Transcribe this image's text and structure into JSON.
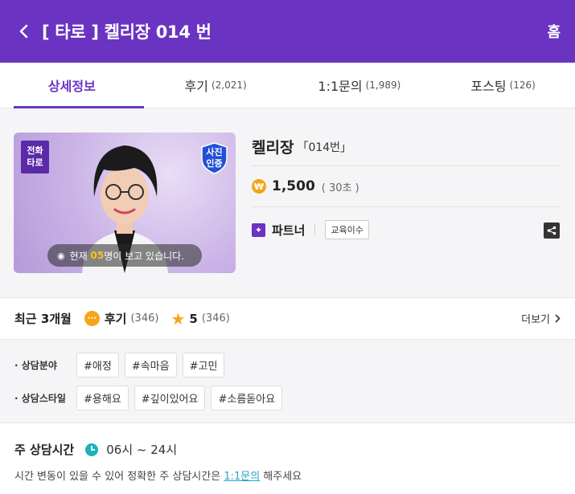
{
  "header": {
    "title": "[ 타로 ] 켈리장 014 번",
    "home": "홈"
  },
  "tabs": [
    {
      "label": "상세정보",
      "count": ""
    },
    {
      "label": "후기",
      "count": "(2,021)"
    },
    {
      "label": "1:1문의",
      "count": "(1,989)"
    },
    {
      "label": "포스팅",
      "count": "(126)"
    }
  ],
  "profile": {
    "badge_type": "전화\n타로",
    "badge_verified": "사진\n인증",
    "viewers_prefix": "현재",
    "viewers_count": "05",
    "viewers_suffix": "명이 보고 있습니다.",
    "name": "켈리장",
    "code": "「014번」",
    "coin_symbol": "₩",
    "price": "1,500",
    "unit": "( 30초 )",
    "partner_label": "파트너",
    "edu_label": "교육이수"
  },
  "reviews": {
    "title": "최근 3개월",
    "review_label": "후기",
    "review_count": "(346)",
    "rating": "5",
    "rating_count": "(346)",
    "more": "더보기"
  },
  "tags": {
    "field_label": "· 상담분야",
    "field_tags": [
      "#애정",
      "#속마음",
      "#고민"
    ],
    "style_label": "· 상담스타일",
    "style_tags": [
      "#용해요",
      "#깊이있어요",
      "#소름돋아요"
    ]
  },
  "hours": {
    "title": "주 상담시간",
    "value": "06시 ~ 24시",
    "note_prefix": "시간 변동이 있을 수 있어 정확한 주 상담시간은 ",
    "note_link": "1:1문의",
    "note_suffix": " 해주세요"
  },
  "colors": {
    "brand": "#6a33c2",
    "accent": "#f6a51a",
    "teal": "#19b3b8"
  }
}
